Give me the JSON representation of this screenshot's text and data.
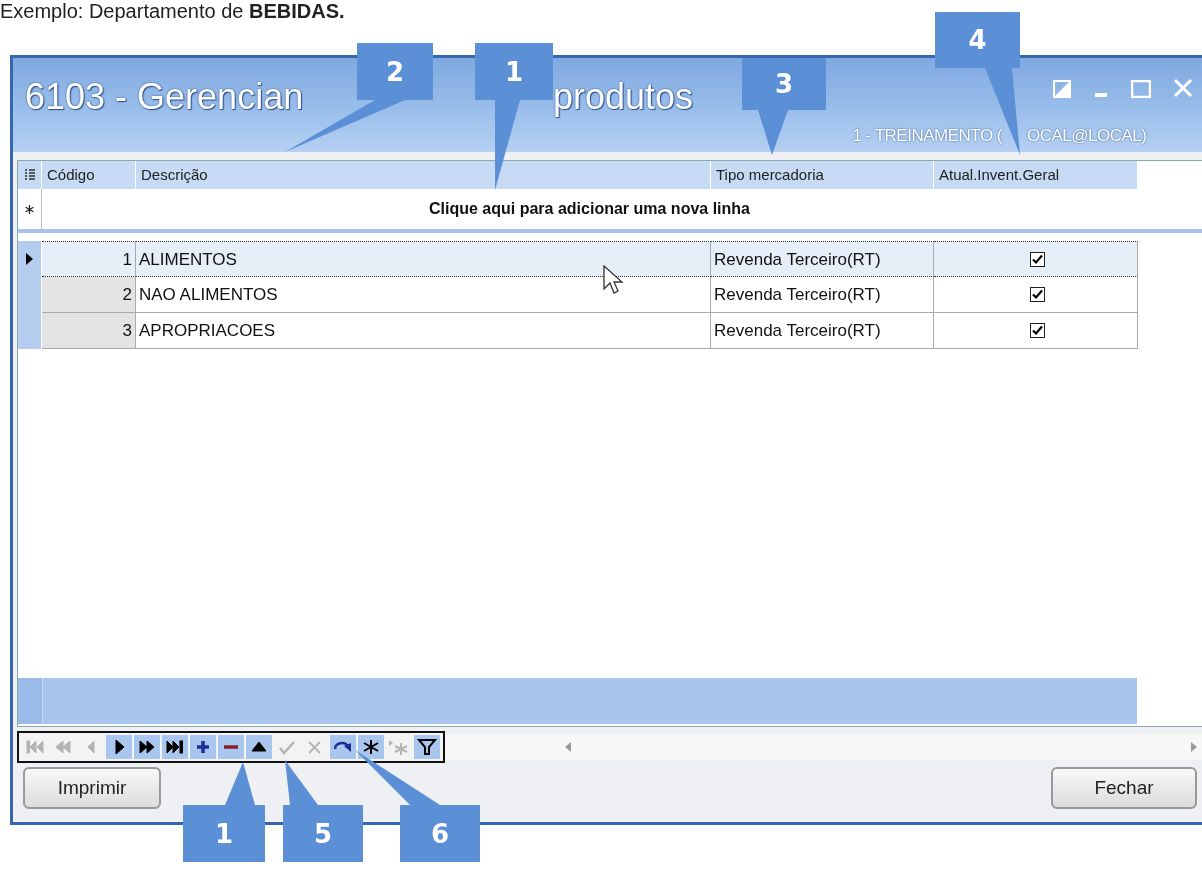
{
  "caption": "Exemplo: Departamento de **BEBIDAS.**",
  "window": {
    "title": [
      "6103 - Gerencian",
      "produtos"
    ],
    "subtitle": [
      "1 - TREINAMENTO (",
      "OCAL@LOCAL)"
    ]
  },
  "table": {
    "columns": [
      "Código",
      "Descrição",
      "Tipo mercadoria",
      "Atual.Invent.Geral"
    ],
    "new_row_prompt": "Clique aqui para adicionar uma nova linha",
    "rows": [
      {
        "codigo": "1",
        "descricao": "ALIMENTOS",
        "tipo": "Revenda Terceiro(RT)",
        "checked": true,
        "selected": true
      },
      {
        "codigo": "2",
        "descricao": "NAO ALIMENTOS",
        "tipo": "Revenda Terceiro(RT)",
        "checked": true,
        "selected": false
      },
      {
        "codigo": "3",
        "descricao": "APROPRIACOES",
        "tipo": "Revenda Terceiro(RT)",
        "checked": true,
        "selected": false
      }
    ]
  },
  "navigator": [
    {
      "disabled": true
    },
    {
      "disabled": true
    },
    {
      "disabled": true
    },
    {
      "disabled": false
    },
    {
      "disabled": false
    },
    {
      "disabled": false
    },
    {
      "disabled": false
    },
    {
      "disabled": false
    },
    {
      "disabled": false
    },
    {
      "disabled": true
    },
    {
      "disabled": true
    },
    {
      "disabled": false
    },
    {
      "disabled": false
    },
    {
      "disabled": true
    },
    {
      "disabled": false
    }
  ],
  "buttons": [
    "Imprimir",
    "Fechar"
  ],
  "callouts": [
    "2",
    "1",
    "3",
    "4",
    "1",
    "5",
    "6"
  ]
}
